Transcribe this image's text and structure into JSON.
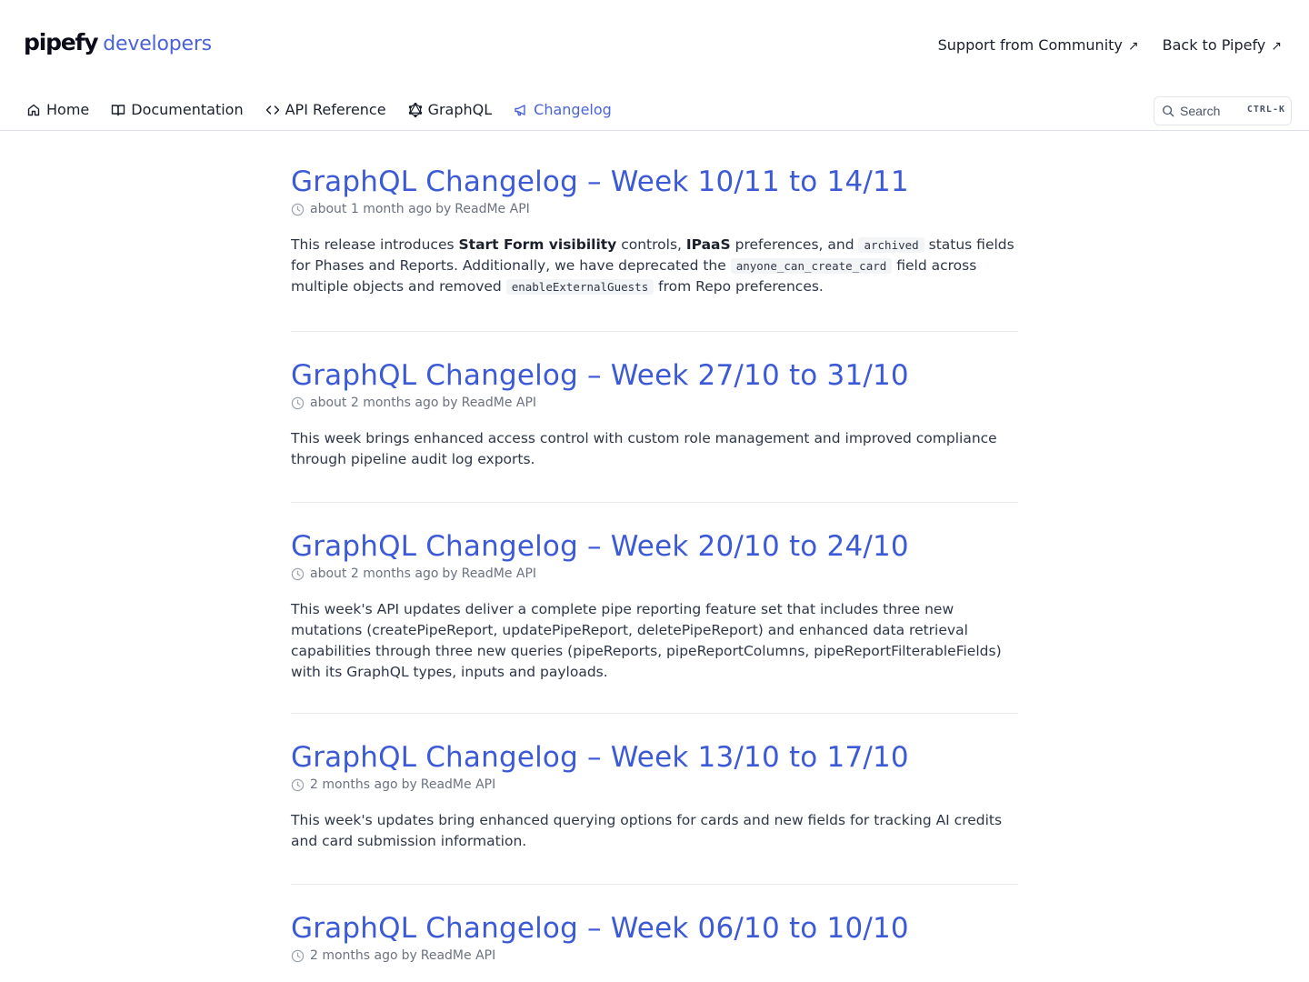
{
  "header": {
    "logo_mark": "pipefy",
    "logo_text": "developers",
    "links": [
      {
        "label": "Support from Community",
        "arrow": "↗"
      },
      {
        "label": "Back to Pipefy",
        "arrow": "↗"
      }
    ]
  },
  "nav": {
    "items": [
      {
        "label": "Home",
        "icon": "home-icon"
      },
      {
        "label": "Documentation",
        "icon": "book-icon"
      },
      {
        "label": "API Reference",
        "icon": "code-icon"
      },
      {
        "label": "GraphQL",
        "icon": "graphql-icon"
      },
      {
        "label": "Changelog",
        "icon": "megaphone-icon",
        "active": true
      }
    ],
    "search": {
      "label": "Search",
      "shortcut": "CTRL-K"
    }
  },
  "colors": {
    "accent": "#3d5ad6",
    "text": "#2d3748",
    "muted": "#6b7280"
  },
  "entries": [
    {
      "title": "GraphQL Changelog – Week 10/11 to 14/11",
      "time": "about 1 month ago",
      "by": "by",
      "author": "ReadMe API",
      "excerpt_parts": [
        "This release introduces ",
        "Start Form visibility",
        " controls, ",
        "IPaaS",
        " preferences, and ",
        "archived",
        " status fields for Phases and Reports. Additionally, we have deprecated the ",
        "anyone_can_create_card",
        " field across multiple objects and removed ",
        "enableExternalGuests",
        " from Repo preferences."
      ]
    },
    {
      "title": "GraphQL Changelog – Week 27/10 to 31/10",
      "time": "about 2 months ago",
      "by": "by",
      "author": "ReadMe API",
      "excerpt": "This week brings enhanced access control with custom role management and improved compliance through pipeline audit log exports."
    },
    {
      "title": "GraphQL Changelog – Week 20/10 to 24/10",
      "time": "about 2 months ago",
      "by": "by",
      "author": "ReadMe API",
      "excerpt": "This week's API updates deliver a complete pipe reporting feature set that includes three new mutations (createPipeReport, updatePipeReport, deletePipeReport) and enhanced data retrieval capabilities through three new queries (pipeReports, pipeReportColumns, pipeReportFilterableFields) with its GraphQL types, inputs and payloads."
    },
    {
      "title": "GraphQL Changelog – Week 13/10 to 17/10",
      "time": "2 months ago",
      "by": "by",
      "author": "ReadMe API",
      "excerpt": "This week's updates bring enhanced querying options for cards and new fields for tracking AI credits and card submission information."
    },
    {
      "title": "GraphQL Changelog – Week 06/10 to 10/10",
      "time": "2 months ago",
      "by": "by",
      "author": "ReadMe API",
      "excerpt": ""
    }
  ]
}
